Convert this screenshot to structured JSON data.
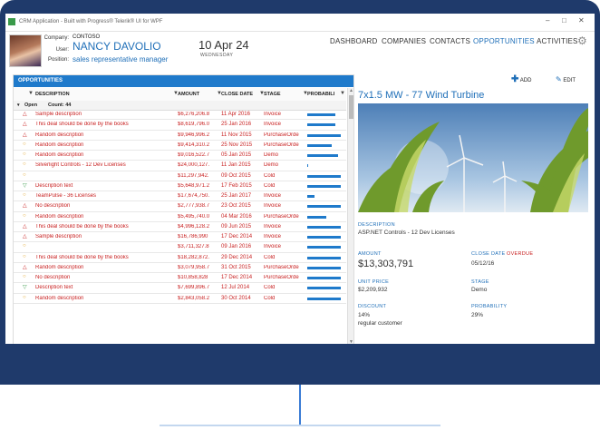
{
  "window": {
    "title": "CRM Application - Built with Progress® Telerik® UI for WPF"
  },
  "header": {
    "labels": {
      "company": "Company:",
      "user": "User:",
      "position": "Position:"
    },
    "company": "CONTOSO",
    "user_name": "NANCY DAVOLIO",
    "position": "sales representative manager",
    "date": "10 Apr 24",
    "weekday": "WEDNESDAY"
  },
  "nav": [
    {
      "label": "DASHBOARD",
      "active": false
    },
    {
      "label": "COMPANIES",
      "active": false
    },
    {
      "label": "CONTACTS",
      "active": false
    },
    {
      "label": "OPPORTUNITIES",
      "active": true
    },
    {
      "label": "ACTIVITIES",
      "active": false
    }
  ],
  "opportunities": {
    "title": "OPPORTUNITIES",
    "columns": {
      "description": "DESCRIPTION",
      "amount": "AMOUNT",
      "close_date": "CLOSE DATE",
      "stage": "STAGE",
      "probability": "PROBABILI"
    },
    "group": {
      "name": "Open",
      "count": "Count: 44"
    },
    "rows": [
      {
        "icon": "warning",
        "description": "Sample description",
        "amount": "$6,276,206.8",
        "close_date": "11 Apr 2016",
        "stage": "Invoice",
        "probability": 0.82
      },
      {
        "icon": "warning",
        "description": "This deal should be done by the books",
        "amount": "$8,619,796.0",
        "close_date": "25 Jan 2016",
        "stage": "Invoice",
        "probability": 0.82
      },
      {
        "icon": "warning",
        "description": "Random description",
        "amount": "$9,946,996.2",
        "close_date": "11 Nov 2015",
        "stage": "PurchaseOrde",
        "probability": 0.98
      },
      {
        "icon": "circle",
        "description": "Random description",
        "amount": "$9,414,310.2",
        "close_date": "25 Nov 2015",
        "stage": "PurchaseOrde",
        "probability": 0.7
      },
      {
        "icon": "circle",
        "description": "Random description",
        "amount": "$9,016,522.7",
        "close_date": "05 Jan 2015",
        "stage": "Demo",
        "probability": 0.9
      },
      {
        "icon": "circle",
        "description": "Silverlight Controls - 12 Dev Licenses",
        "amount": "$24,000,127.",
        "close_date": "11 Jan 2015",
        "stage": "Demo",
        "probability": 0.02
      },
      {
        "icon": "circle",
        "description": "",
        "amount": "$11,297,942.",
        "close_date": "09 Oct 2015",
        "stage": "Cold",
        "probability": 0.98
      },
      {
        "icon": "down",
        "description": "Description text",
        "amount": "$5,648,971.2",
        "close_date": "17 Feb 2015",
        "stage": "Cold",
        "probability": 0.98
      },
      {
        "icon": "circle",
        "description": "TeamPulse - 36 Licenses",
        "amount": "$17,674,750.",
        "close_date": "25 Jan 2017",
        "stage": "Invoice",
        "probability": 0.22
      },
      {
        "icon": "warning",
        "description": "No description",
        "amount": "$2,777,938.7",
        "close_date": "23 Oct 2015",
        "stage": "Invoice",
        "probability": 0.98
      },
      {
        "icon": "circle",
        "description": "Random description",
        "amount": "$5,495,740.0",
        "close_date": "04 Mar 2016",
        "stage": "PurchaseOrde",
        "probability": 0.55
      },
      {
        "icon": "warning",
        "description": "This deal should be done by the books",
        "amount": "$4,996,128.2",
        "close_date": "09 Jun 2015",
        "stage": "Invoice",
        "probability": 0.98
      },
      {
        "icon": "warning",
        "description": "Sample description",
        "amount": "$16,786,990",
        "close_date": "17 Dec 2014",
        "stage": "Invoice",
        "probability": 0.98
      },
      {
        "icon": "circle",
        "description": "",
        "amount": "$3,711,327.8",
        "close_date": "09 Jan 2016",
        "stage": "Invoice",
        "probability": 0.98
      },
      {
        "icon": "circle",
        "description": "This deal should be done by the books",
        "amount": "$18,282,872.",
        "close_date": "29 Dec 2014",
        "stage": "Cold",
        "probability": 0.98
      },
      {
        "icon": "warning",
        "description": "Random description",
        "amount": "$3,079,958.7",
        "close_date": "31 Oct 2015",
        "stage": "PurchaseOrde",
        "probability": 0.98
      },
      {
        "icon": "circle",
        "description": "No description",
        "amount": "$10,858,828",
        "close_date": "17 Dec 2014",
        "stage": "PurchaseOrde",
        "probability": 0.98
      },
      {
        "icon": "down",
        "description": "Description text",
        "amount": "$7,699,896.7",
        "close_date": "12 Jul 2014",
        "stage": "Cold",
        "probability": 0.98
      },
      {
        "icon": "circle",
        "description": "Random description",
        "amount": "$2,843,058.2",
        "close_date": "30 Oct 2014",
        "stage": "Cold",
        "probability": 0.98
      }
    ]
  },
  "details": {
    "add_label": "ADD",
    "edit_label": "EDIT",
    "title": "7x1.5 MW - 77 Wind Turbine",
    "description_label": "DESCRIPTION",
    "description": "ASP.NET Controls - 12 Dev Licenses",
    "amount_label": "AMOUNT",
    "amount": "$13,303,791",
    "close_date_label": "CLOSE DATE",
    "overdue_label": "OVERDUE",
    "close_date": "05/12/16",
    "unit_price_label": "UNIT PRICE",
    "unit_price": "$2,209,932",
    "stage_label": "STAGE",
    "stage": "Demo",
    "discount_label": "DISCOUNT",
    "discount": "14%",
    "discount_note": "regular customer",
    "probability_label": "PROBABILITY",
    "probability": "29%"
  },
  "colors": {
    "accent": "#1f7acb",
    "link": "#1f6fb8",
    "overdue": "#c81f1f",
    "frame": "#1f3a6b"
  }
}
